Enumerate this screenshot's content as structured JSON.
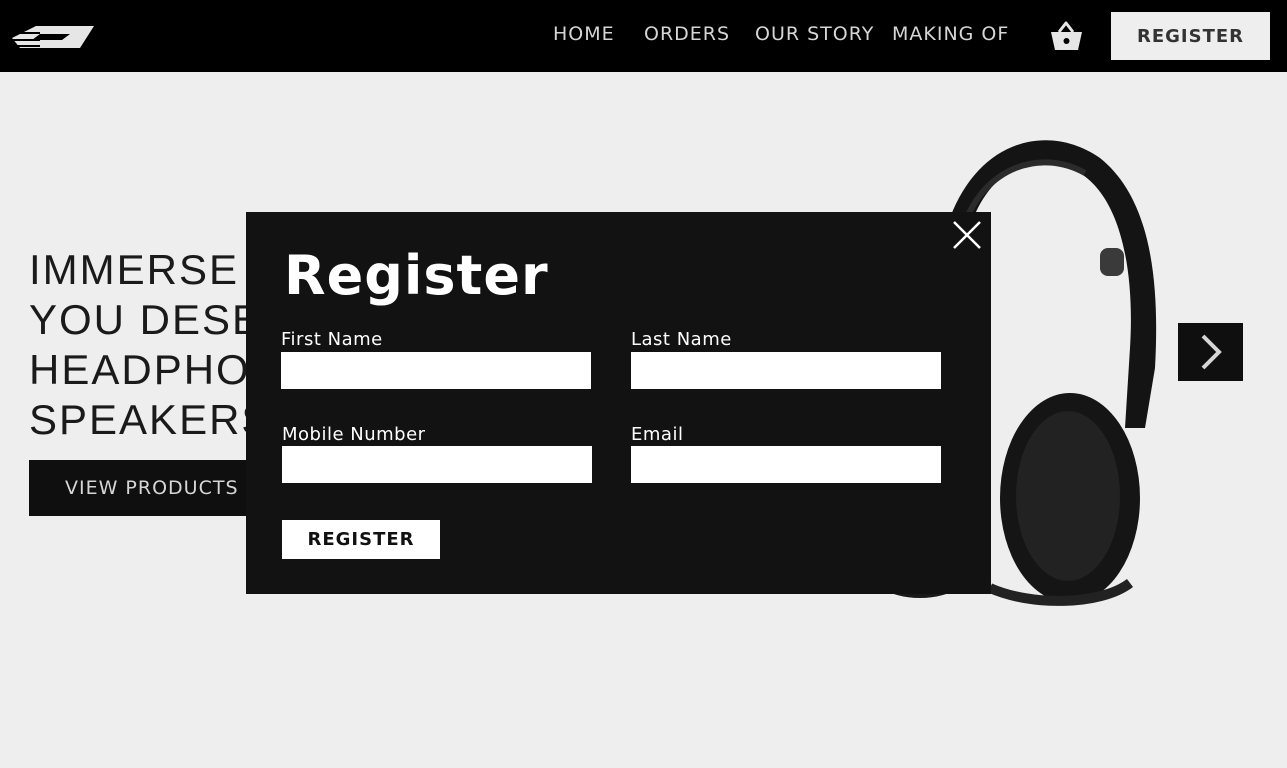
{
  "nav": {
    "logo_icon": "brand-logo",
    "links": [
      {
        "label": "HOME"
      },
      {
        "label": "ORDERS"
      },
      {
        "label": "OUR STORY"
      },
      {
        "label": "MAKING OF"
      }
    ],
    "cart_icon": "shopping-basket-icon",
    "register_label": "REGISTER"
  },
  "hero": {
    "lines": [
      "IMMERSE YO",
      "YOU DESERV",
      "HEADPHONE",
      "SPEAKERS."
    ],
    "cta_label": "VIEW PRODUCTS",
    "next_icon": "chevron-right-icon"
  },
  "modal": {
    "title": "Register",
    "close_icon": "close-icon",
    "fields": {
      "first_name": {
        "label": "First Name",
        "value": ""
      },
      "last_name": {
        "label": "Last Name",
        "value": ""
      },
      "mobile": {
        "label": "Mobile Number",
        "value": ""
      },
      "email": {
        "label": "Email",
        "value": ""
      }
    },
    "submit_label": "REGISTER"
  },
  "colors": {
    "nav_bg": "#000000",
    "page_bg": "#eeeeee",
    "modal_bg": "#121212",
    "button_dark": "#0f0f0f"
  }
}
